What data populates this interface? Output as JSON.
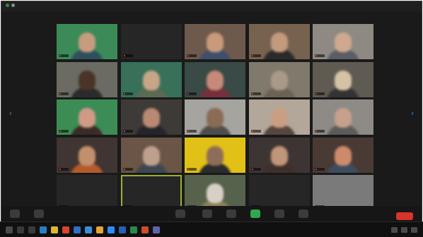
{
  "window": {
    "title": "",
    "view_label": ""
  },
  "participants": [
    {
      "name": "",
      "kind": "video",
      "bg": "#3c8a58",
      "face": "#c79c7e",
      "body": "#2f4f5e"
    },
    {
      "name": "",
      "kind": "name",
      "bg": "#262626"
    },
    {
      "name": "",
      "kind": "video",
      "bg": "#6e5a4d",
      "face": "#c89a7b",
      "body": "#3f4f6a"
    },
    {
      "name": "",
      "kind": "video",
      "bg": "#77624f",
      "face": "#c49a7e",
      "body": "#2a2a2a"
    },
    {
      "name": "",
      "kind": "video",
      "bg": "#8e8a83",
      "face": "#cfa88e",
      "body": "#5a5c66"
    },
    {
      "name": "",
      "kind": "video",
      "bg": "#6b6b63",
      "face": "#4a3427",
      "body": "#2b2b2b"
    },
    {
      "name": "",
      "kind": "video",
      "bg": "#38705a",
      "face": "#c9a587",
      "body": "#5a6b52"
    },
    {
      "name": "",
      "kind": "video",
      "bg": "#3a4a46",
      "face": "#c98978",
      "body": "#772f3c"
    },
    {
      "name": "",
      "kind": "video",
      "bg": "#7f7a6c",
      "face": "#a89a86",
      "body": "#6b6255"
    },
    {
      "name": "",
      "kind": "video",
      "bg": "#5f5a52",
      "face": "#d6c3a5",
      "body": "#333333"
    },
    {
      "name": "",
      "kind": "video",
      "bg": "#3c8d55",
      "face": "#cf9a86",
      "body": "#3b2b26"
    },
    {
      "name": "",
      "kind": "video",
      "bg": "#3d3a38",
      "face": "#b98a71",
      "body": "#24242a"
    },
    {
      "name": "",
      "kind": "video",
      "bg": "#a6a49e",
      "face": "#8a6b55",
      "body": "#4d4d4d"
    },
    {
      "name": "",
      "kind": "video",
      "bg": "#b3a79a",
      "face": "#c89f82",
      "body": "#55463f"
    },
    {
      "name": "",
      "kind": "video",
      "bg": "#8e8a86",
      "face": "#c6a08a",
      "body": "#5b5b5b"
    },
    {
      "name": "",
      "kind": "video",
      "bg": "#403532",
      "face": "#c2906d",
      "body": "#b45a2d"
    },
    {
      "name": "",
      "kind": "video",
      "bg": "#6a5546",
      "face": "#bfa08f",
      "body": "#3d4652"
    },
    {
      "name": "",
      "kind": "video",
      "bg": "#e2c117",
      "face": "#8e6d58",
      "body": "#2b2b2b"
    },
    {
      "name": "",
      "kind": "video",
      "bg": "#3d3533",
      "face": "#c1957a",
      "body": "#3f2f2a"
    },
    {
      "name": "",
      "kind": "video",
      "bg": "#4a3a34",
      "face": "#cd8b6c",
      "body": "#3d4d60"
    },
    {
      "name": "",
      "kind": "name",
      "bg": "#262626"
    },
    {
      "name": "",
      "kind": "name",
      "bg": "#262626",
      "active": true
    },
    {
      "name": "",
      "kind": "video",
      "bg": "#56624c",
      "face": "#d7d1c5",
      "body": "#8a7f58"
    },
    {
      "name": "",
      "kind": "name",
      "bg": "#262626"
    },
    {
      "name": "",
      "kind": "name",
      "bg": "#7a7a7a"
    }
  ],
  "toolbar": {
    "buttons": [
      {
        "icon": "mute-icon",
        "green": false
      },
      {
        "icon": "video-camera-icon",
        "green": false
      },
      {
        "icon": "security-icon",
        "green": false
      },
      {
        "icon": "participants-icon",
        "green": false
      },
      {
        "icon": "chat-icon",
        "green": false
      },
      {
        "icon": "share-screen-icon",
        "green": true
      },
      {
        "icon": "record-icon",
        "green": false
      },
      {
        "icon": "reactions-icon",
        "green": false
      }
    ],
    "end_label": ""
  },
  "taskbar": {
    "icons": [
      {
        "icon": "start-icon",
        "color": "#4a4a4a"
      },
      {
        "icon": "search-icon",
        "color": "#3a3a3a"
      },
      {
        "icon": "task-view-icon",
        "color": "#3a3a3a"
      },
      {
        "icon": "edge-icon",
        "color": "#2a7ec5"
      },
      {
        "icon": "file-explorer-icon",
        "color": "#e0b43a"
      },
      {
        "icon": "chrome-icon",
        "color": "#d9442f"
      },
      {
        "icon": "mail-icon",
        "color": "#2f6fc4"
      },
      {
        "icon": "store-icon",
        "color": "#3c8fd6"
      },
      {
        "icon": "photos-icon",
        "color": "#e2a53a"
      },
      {
        "icon": "zoom-icon",
        "color": "#2d8cff"
      },
      {
        "icon": "word-icon",
        "color": "#2b5fb3"
      },
      {
        "icon": "excel-icon",
        "color": "#2a8a4a"
      },
      {
        "icon": "powerpoint-icon",
        "color": "#d04b2c"
      },
      {
        "icon": "teams-icon",
        "color": "#6264a7"
      }
    ]
  }
}
